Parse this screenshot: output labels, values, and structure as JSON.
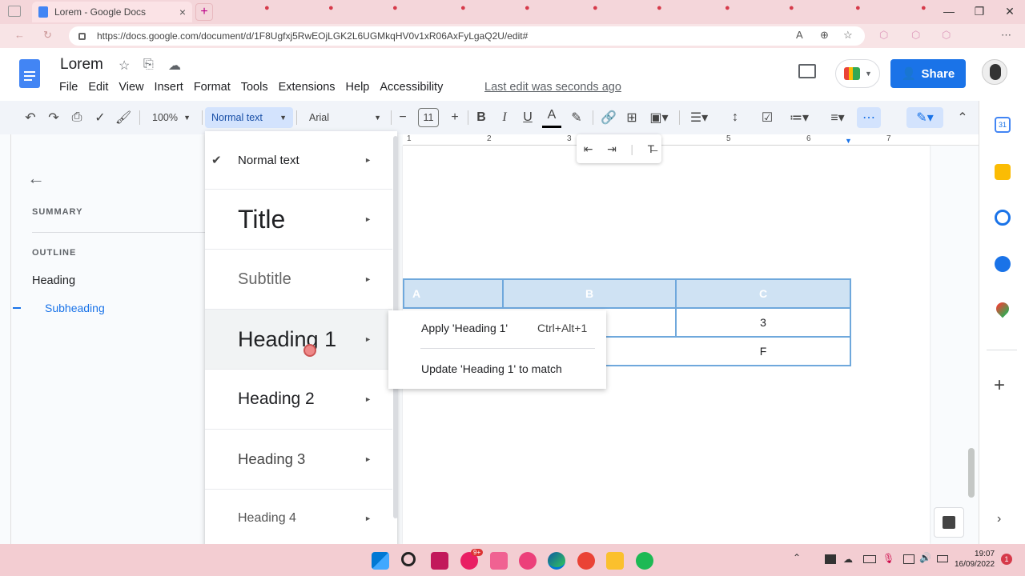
{
  "browser": {
    "tab_title": "Lorem - Google Docs",
    "url": "https://docs.google.com/document/d/1F8Ugfxj5RwEOjLGK2L6UGMkqHV0v1xR06AxFyLgaQ2U/edit#"
  },
  "doc": {
    "title": "Lorem",
    "menus": [
      "File",
      "Edit",
      "View",
      "Insert",
      "Format",
      "Tools",
      "Extensions",
      "Help",
      "Accessibility"
    ],
    "last_edit": "Last edit was seconds ago",
    "share_label": "Share"
  },
  "toolbar": {
    "zoom": "100%",
    "style": "Normal text",
    "font": "Arial",
    "font_size": "11",
    "minus": "−",
    "plus": "+",
    "bold": "B",
    "italic": "I",
    "underline": "U",
    "text_color": "A"
  },
  "outline_panel": {
    "summary_label": "SUMMARY",
    "outline_label": "OUTLINE",
    "items": [
      {
        "label": "Heading"
      },
      {
        "label": "Subheading"
      }
    ]
  },
  "style_menu": {
    "items": [
      {
        "label": "Normal text",
        "checked": true
      },
      {
        "label": "Title"
      },
      {
        "label": "Subtitle"
      },
      {
        "label": "Heading 1"
      },
      {
        "label": "Heading 2"
      },
      {
        "label": "Heading 3"
      },
      {
        "label": "Heading 4"
      }
    ]
  },
  "submenu": {
    "apply_label": "Apply 'Heading 1'",
    "apply_shortcut": "Ctrl+Alt+1",
    "update_label": "Update 'Heading 1' to match"
  },
  "ruler": {
    "numbers": [
      "1",
      "2",
      "3",
      "5",
      "6",
      "7"
    ]
  },
  "table": {
    "headers": [
      "A",
      "B",
      "C"
    ],
    "rows": [
      [
        "",
        "",
        "3"
      ],
      [
        "",
        "",
        "F"
      ]
    ]
  },
  "taskbar": {
    "time": "19:07",
    "date": "16/09/2022",
    "badge": "9+"
  },
  "colors": {
    "accent": "#1a73e8",
    "table_border": "#6fa8dc",
    "table_header": "#cfe2f3"
  }
}
